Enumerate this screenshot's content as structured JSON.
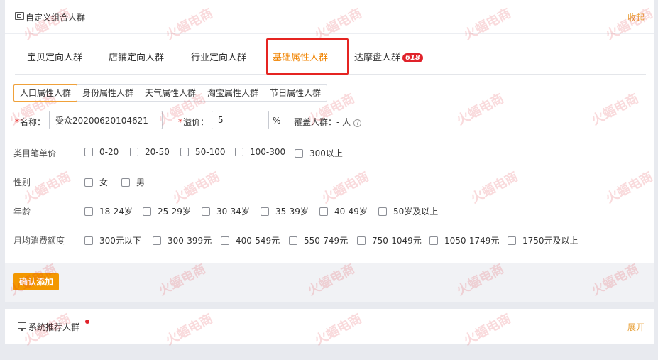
{
  "panel_top": {
    "title": "自定义组合人群",
    "collapse_label": "收起"
  },
  "tabs": [
    {
      "label": "宝贝定向人群"
    },
    {
      "label": "店铺定向人群"
    },
    {
      "label": "行业定向人群"
    },
    {
      "label": "基础属性人群"
    },
    {
      "label": "达摩盘人群",
      "badge": "618"
    }
  ],
  "subtabs": [
    {
      "label": "人口属性人群"
    },
    {
      "label": "身份属性人群"
    },
    {
      "label": "天气属性人群"
    },
    {
      "label": "淘宝属性人群"
    },
    {
      "label": "节日属性人群"
    }
  ],
  "form": {
    "name_label": "名称：",
    "name_value": "受众20200620104621",
    "premium_label": "溢价：",
    "premium_value": "5",
    "premium_unit": "%",
    "cover_label": "覆盖人群：",
    "cover_value": "- 人",
    "help_icon": "question-circle-icon"
  },
  "groups": {
    "price": {
      "label": "类目笔单价",
      "options": [
        "0-20",
        "20-50",
        "50-100",
        "100-300",
        "300以上"
      ]
    },
    "gender": {
      "label": "性别",
      "options": [
        "女",
        "男"
      ]
    },
    "age": {
      "label": "年龄",
      "options": [
        "18-24岁",
        "25-29岁",
        "30-34岁",
        "35-39岁",
        "40-49岁",
        "50岁及以上"
      ]
    },
    "spend": {
      "label": "月均消费额度",
      "options": [
        "300元以下",
        "300-399元",
        "400-549元",
        "550-749元",
        "750-1049元",
        "1050-1749元",
        "1750元及以上"
      ]
    }
  },
  "confirm_button": "确认添加",
  "panel_bottom": {
    "title": "系统推荐人群",
    "expand_label": "展开"
  },
  "watermark": {
    "text": "火蝠电商",
    "color": "#e0222a"
  },
  "colors": {
    "accent": "#f08300",
    "highlight_box": "#e52421",
    "button": "#f39800",
    "link": "#e8a23b"
  }
}
